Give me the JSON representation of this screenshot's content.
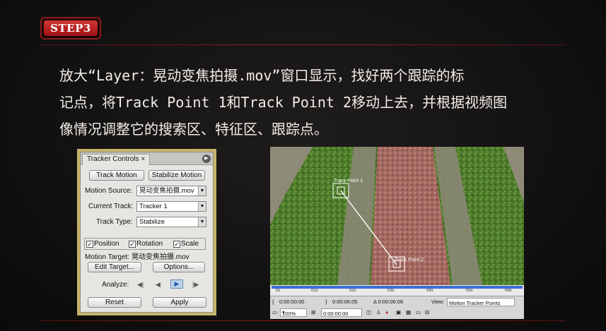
{
  "badge": {
    "label": "STEP3"
  },
  "instructions": {
    "line1": "放大“Layer：晃动变焦拍摄.mov”窗口显示，找好两个跟踪的标",
    "line2": "记点，将Track Point 1和Track Point 2移动上去，并根据视频图",
    "line3": "像情况调整它的搜索区、特征区、跟踪点。"
  },
  "tracker": {
    "tab_label": "Tracker Controls ×",
    "track_motion": "Track Motion",
    "stabilize_motion": "Stabilize Motion",
    "motion_source_label": "Motion Source:",
    "motion_source_value": "晃动变焦拍摄.mov",
    "current_track_label": "Current Track:",
    "current_track_value": "Tracker 1",
    "track_type_label": "Track Type:",
    "track_type_value": "Stabilize",
    "position": "Position",
    "rotation": "Rotation",
    "scale": "Scale",
    "motion_target": "Motion Target: 晃动变焦拍摄.mov",
    "edit_target": "Edit Target...",
    "options": "Options...",
    "analyze_label": "Analyze:",
    "reset": "Reset",
    "apply": "Apply"
  },
  "viewer": {
    "track_point_1": "Track Point 1",
    "track_point_2": "Track Point 2",
    "ticks": [
      "0s",
      "01s",
      "02s",
      "03s",
      "04s",
      "05s",
      "06s"
    ],
    "time_start": "0:00:00:00",
    "time_end": "0:00:06:05",
    "duration": "Δ 0:00:06:06",
    "view_label": "View:",
    "view_value": "Motion Tracker Points",
    "zoom": "100%",
    "current_time": "0:00:00:00"
  },
  "colors": {
    "accent": "#c42828",
    "rule": "#7a1a1a",
    "text": "#f2ede6"
  }
}
